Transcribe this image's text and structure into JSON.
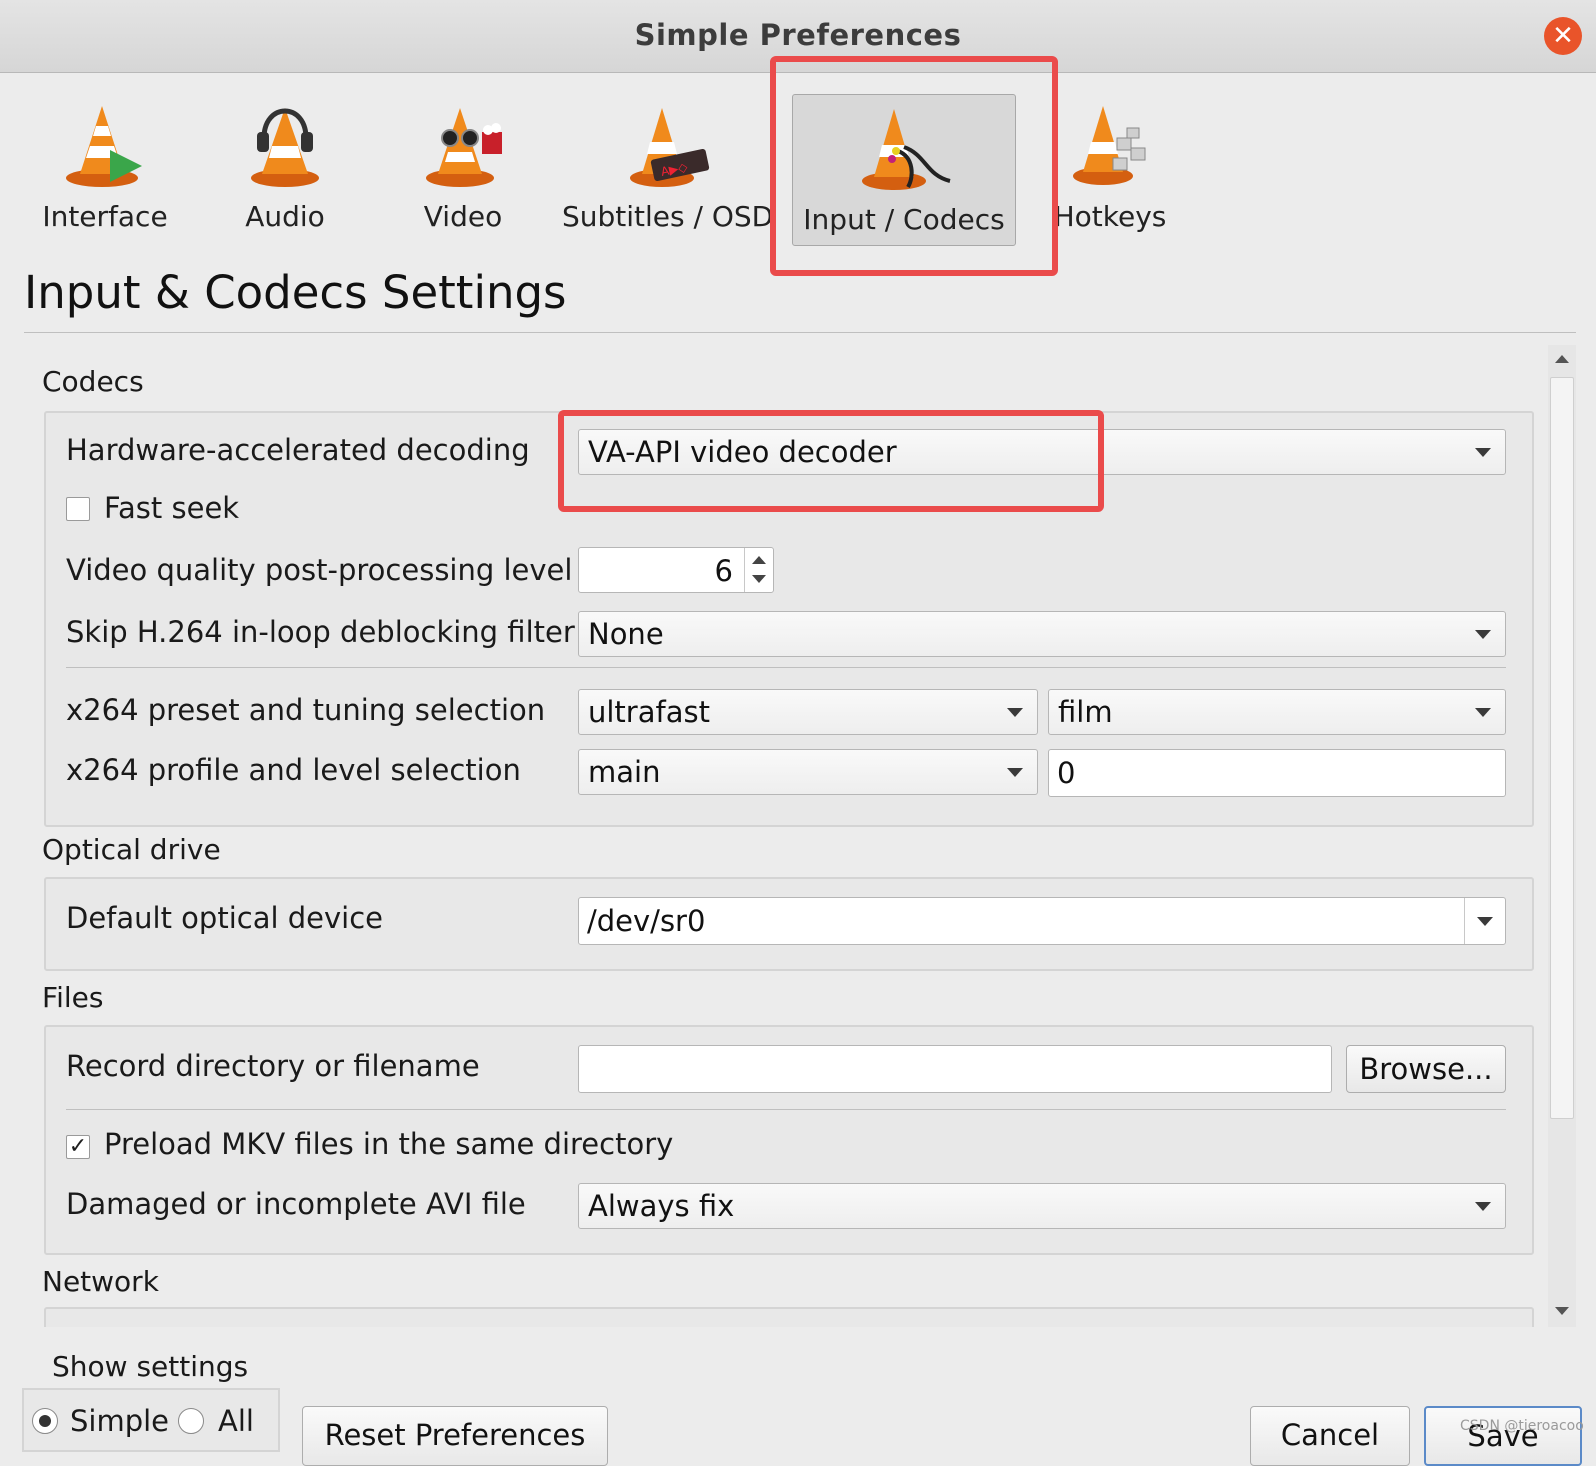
{
  "window": {
    "title": "Simple Preferences",
    "close_symbol": "✕"
  },
  "categories": [
    {
      "label": "Interface",
      "icon": "interface-cone-icon"
    },
    {
      "label": "Audio",
      "icon": "audio-cone-headphones-icon"
    },
    {
      "label": "Video",
      "icon": "video-cone-glasses-icon"
    },
    {
      "label": "Subtitles / OSD",
      "icon": "subtitles-cone-icon"
    },
    {
      "label": "Input / Codecs",
      "icon": "input-codecs-cone-icon",
      "selected": true
    },
    {
      "label": "Hotkeys",
      "icon": "hotkeys-cone-icon"
    }
  ],
  "page_title": "Input & Codecs Settings",
  "codecs": {
    "section_title": "Codecs",
    "hw_decoding_label": "Hardware-accelerated decoding",
    "hw_decoding_value": "VA-API video decoder",
    "fast_seek_label": "Fast seek",
    "fast_seek_checked": false,
    "postproc_label": "Video quality post-processing level",
    "postproc_value": "6",
    "skip_h264_label": "Skip H.264 in-loop deblocking filter",
    "skip_h264_value": "None",
    "x264_preset_label": "x264 preset and tuning selection",
    "x264_preset_value": "ultrafast",
    "x264_tuning_value": "film",
    "x264_profile_label": "x264 profile and level selection",
    "x264_profile_value": "main",
    "x264_level_value": "0"
  },
  "optical": {
    "section_title": "Optical drive",
    "device_label": "Default optical device",
    "device_value": "/dev/sr0"
  },
  "files": {
    "section_title": "Files",
    "record_label": "Record directory or filename",
    "record_value": "",
    "browse_label": "Browse...",
    "preload_mkv_label": "Preload MKV files in the same directory",
    "preload_mkv_checked": true,
    "check_mark": "✓",
    "avi_label": "Damaged or incomplete AVI file",
    "avi_value": "Always fix"
  },
  "network": {
    "section_title": "Network"
  },
  "footer": {
    "show_settings_label": "Show settings",
    "simple_label": "Simple",
    "all_label": "All",
    "selected_mode": "Simple",
    "reset_label": "Reset Preferences",
    "cancel_label": "Cancel",
    "save_label": "Save"
  },
  "watermark": "CSDN @tieroacoo",
  "colors": {
    "highlight_red": "#ea4b4b",
    "close_orange": "#e9542a",
    "cone_orange": "#f08a1c"
  }
}
